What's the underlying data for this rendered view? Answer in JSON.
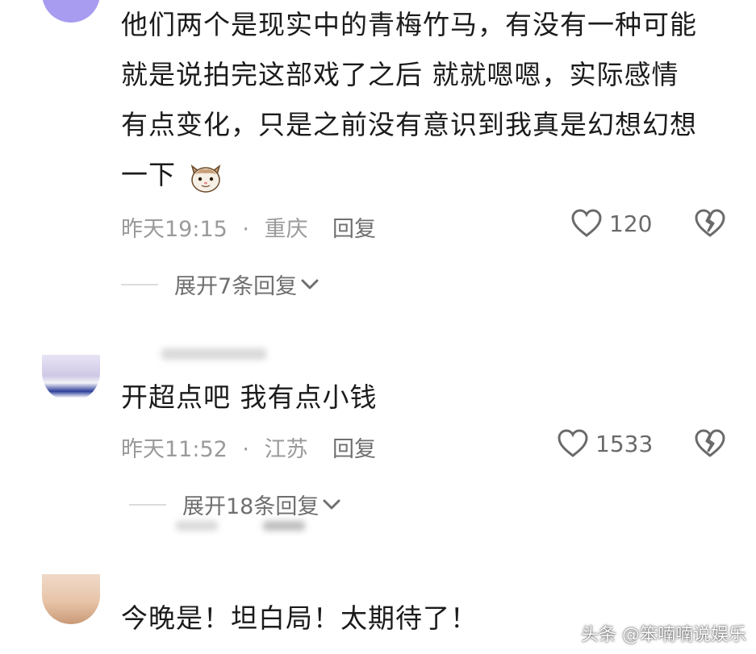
{
  "comments": [
    {
      "lines": [
        "他们两个是现实中的青梅竹马，有没有一种可能",
        "就是说拍完这部戏了之后 就就嗯嗯，实际感情",
        "有点变化，只是之前没有意识到我真是幻想幻想",
        "一下"
      ],
      "emoji": "cat-face-emoji",
      "time": "昨天19:15",
      "location": "重庆",
      "reply_label": "回复",
      "likes": "120",
      "expand_label": "展开7条回复"
    },
    {
      "lines": [
        "开超点吧 我有点小钱"
      ],
      "time": "昨天11:52",
      "location": "江苏",
      "reply_label": "回复",
      "likes": "1533",
      "expand_label": "展开18条回复"
    },
    {
      "lines": [
        "今晚是！坦白局！太期待了！"
      ]
    }
  ],
  "separator": "·",
  "watermark": "头条 @笨喃喃说娱乐",
  "icons": [
    "heart-icon",
    "broken-heart-icon",
    "chevron-down-icon"
  ],
  "colors": {
    "text": "#1b1b1b",
    "meta": "#9a9a9a",
    "avatar1": "#a79cf0"
  }
}
